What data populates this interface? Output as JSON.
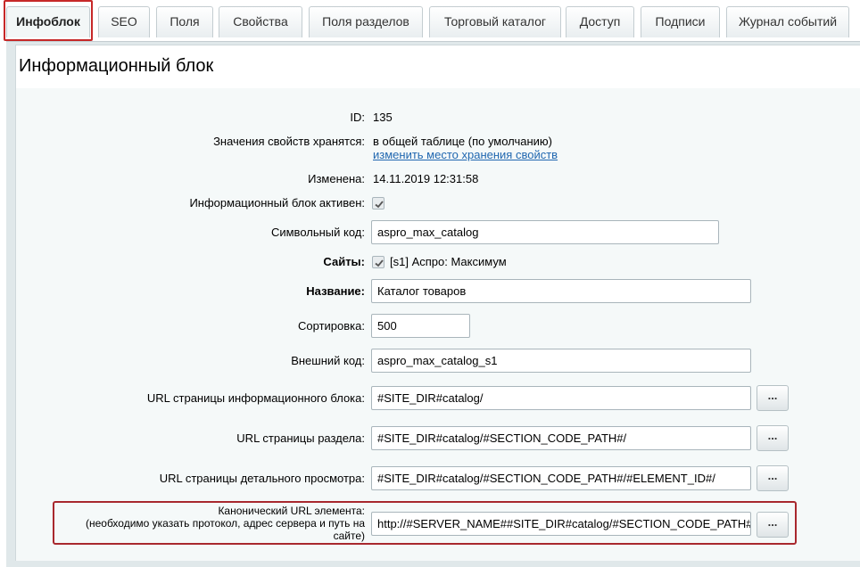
{
  "tabs": [
    {
      "label": "Инфоблок"
    },
    {
      "label": "SEO"
    },
    {
      "label": "Поля"
    },
    {
      "label": "Свойства"
    },
    {
      "label": "Поля разделов"
    },
    {
      "label": "Торговый каталог"
    },
    {
      "label": "Доступ"
    },
    {
      "label": "Подписи"
    },
    {
      "label": "Журнал событий"
    }
  ],
  "active_tab": "Инфоблок",
  "panel_title": "Информационный блок",
  "fields": {
    "id": {
      "label": "ID:",
      "value": "135"
    },
    "storage": {
      "label": "Значения свойств хранятся:",
      "value": "в общей таблице (по умолчанию)",
      "link": "изменить место хранения свойств"
    },
    "modified": {
      "label": "Изменена:",
      "value": "14.11.2019 12:31:58"
    },
    "active": {
      "label": "Информационный блок активен:",
      "checked": true
    },
    "code": {
      "label": "Символьный код:",
      "value": "aspro_max_catalog"
    },
    "sites": {
      "label": "Сайты:",
      "value": "[s1] Аспро: Максимум",
      "checked": true
    },
    "name": {
      "label": "Название:",
      "value": "Каталог товаров"
    },
    "sort": {
      "label": "Сортировка:",
      "value": "500"
    },
    "xml_id": {
      "label": "Внешний код:",
      "value": "aspro_max_catalog_s1"
    },
    "list_url": {
      "label": "URL страницы информационного блока:",
      "value": "#SITE_DIR#catalog/",
      "button": "..."
    },
    "section_url": {
      "label": "URL страницы раздела:",
      "value": "#SITE_DIR#catalog/#SECTION_CODE_PATH#/",
      "button": "..."
    },
    "detail_url": {
      "label": "URL страницы детального просмотра:",
      "value": "#SITE_DIR#catalog/#SECTION_CODE_PATH#/#ELEMENT_ID#/",
      "button": "..."
    },
    "canonical_url": {
      "label_line1": "Канонический URL элемента:",
      "label_line2": "(необходимо указать протокол, адрес сервера и путь на",
      "label_line3": "сайте)",
      "value": "http://#SERVER_NAME##SITE_DIR#catalog/#SECTION_CODE_PATH#/#ELEMENT_CODE#/",
      "button": "..."
    }
  },
  "colors": {
    "highlight": "#a8282e",
    "link": "#2067b0",
    "panel_bg": "#f5f9f9"
  }
}
